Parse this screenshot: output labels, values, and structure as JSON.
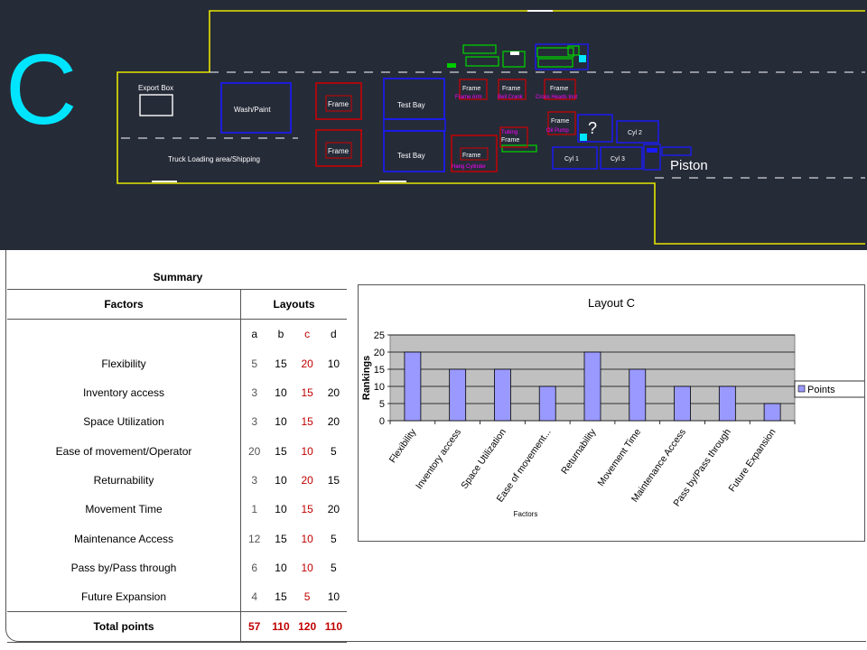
{
  "cad": {
    "big_letter": "C",
    "labels": {
      "export_box": "Export Box",
      "wash_paint": "Wash/Paint",
      "frame1": "Frame",
      "frame2": "Frame",
      "test_bay1": "Test Bay",
      "test_bay2": "Test Bay",
      "truck_loading": "Truck Loading area/Shipping",
      "frame_arm_t": "Frame",
      "frame_arm_b": "Frame Arm",
      "bell_crank_t": "Frame",
      "bell_crank_b": "Bell Crank",
      "cross_heads_t": "Frame",
      "cross_heads_b": "Cross Heads Inst",
      "tubing": "Tubing",
      "frame_tub": "Frame",
      "hang_cyl_t": "Frame",
      "hang_cyl_b": "Hang Cylinder",
      "oil_pump_t": "Frame",
      "oil_pump_b": "Oil Pump",
      "question": "?",
      "cyl2": "Cyl 2",
      "cyl1": "Cyl 1",
      "cyl3": "Cyl 3",
      "piston": "Piston"
    },
    "colors": {
      "background": "#262b38",
      "boundary": "#e6e600",
      "blue_box": "#1a1aff",
      "red_box": "#d00000",
      "green_box": "#00cc00",
      "magenta_text": "#ff00ff",
      "cyan_letter": "#00e5ff",
      "white": "#ffffff"
    }
  },
  "summary": {
    "title": "Summary",
    "factors_header": "Factors",
    "layouts_header": "Layouts",
    "layout_letters": [
      "a",
      "b",
      "c",
      "d"
    ],
    "rows": [
      {
        "factor": "Flexibility",
        "a": "5",
        "b": "15",
        "c": "20",
        "d": "10"
      },
      {
        "factor": "Inventory access",
        "a": "3",
        "b": "10",
        "c": "15",
        "d": "20"
      },
      {
        "factor": "Space Utilization",
        "a": "3",
        "b": "10",
        "c": "15",
        "d": "20"
      },
      {
        "factor": "Ease of movement/Operator",
        "a": "20",
        "b": "15",
        "c": "10",
        "d": "5"
      },
      {
        "factor": "Returnability",
        "a": "3",
        "b": "10",
        "c": "20",
        "d": "15"
      },
      {
        "factor": "Movement Time",
        "a": "1",
        "b": "10",
        "c": "15",
        "d": "20"
      },
      {
        "factor": "Maintenance Access",
        "a": "12",
        "b": "15",
        "c": "10",
        "d": "5"
      },
      {
        "factor": "Pass by/Pass through",
        "a": "6",
        "b": "10",
        "c": "10",
        "d": "5"
      },
      {
        "factor": "Future Expansion",
        "a": "4",
        "b": "15",
        "c": "5",
        "d": "10"
      }
    ],
    "total": {
      "label": "Total points",
      "a": "57",
      "b": "110",
      "c": "120",
      "d": "110"
    }
  },
  "chart_data": {
    "type": "bar",
    "title": "Layout C",
    "xlabel": "Factors",
    "ylabel": "Rankings",
    "categories": [
      "Flexibility",
      "Inventory access",
      "Space Utilization",
      "Ease of movement...",
      "Returnability",
      "Movement Time",
      "Maintenance Access",
      "Pass by/Pass through",
      "Future Expansion"
    ],
    "series": [
      {
        "name": "Points",
        "values": [
          20,
          15,
          15,
          10,
          20,
          15,
          10,
          10,
          5
        ]
      }
    ],
    "ylim": [
      0,
      25
    ],
    "yticks": [
      0,
      5,
      10,
      15,
      20,
      25
    ],
    "grid": true,
    "legend": "right",
    "colors": {
      "bar": "#9999ff",
      "plot_bg": "#c0c0c0"
    }
  }
}
